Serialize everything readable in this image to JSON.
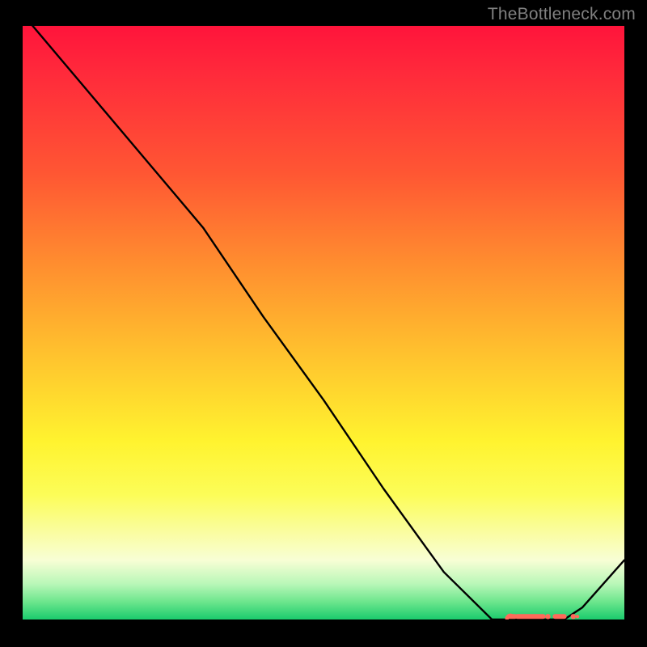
{
  "watermark": "TheBottleneck.com",
  "chart_data": {
    "type": "line",
    "title": "",
    "xlabel": "",
    "ylabel": "",
    "xlim": [
      0,
      100
    ],
    "ylim": [
      0,
      100
    ],
    "series": [
      {
        "name": "curve",
        "color": "#000000",
        "x": [
          0,
          10,
          20,
          25,
          30,
          40,
          50,
          60,
          70,
          78,
          82,
          85,
          88,
          90,
          93,
          100
        ],
        "y": [
          102,
          90,
          78,
          72,
          66,
          51,
          37,
          22,
          8,
          0,
          0,
          0,
          0,
          0,
          2,
          10
        ]
      }
    ],
    "markers": {
      "color": "#ff6a5a",
      "shape": "dash-dot",
      "x_range": [
        81,
        92
      ],
      "y": 0.5
    }
  }
}
